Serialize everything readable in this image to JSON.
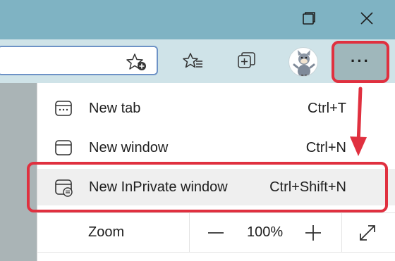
{
  "window": {
    "controls": [
      "restore-icon",
      "close-icon"
    ]
  },
  "toolbar": {
    "address_icon": "add-to-favorites-icon",
    "buttons": [
      "favorites-icon",
      "collections-icon",
      "profile-avatar",
      "more-icon"
    ],
    "more_label": "···"
  },
  "menu": {
    "items": [
      {
        "icon": "new-tab-icon",
        "label": "New tab",
        "shortcut": "Ctrl+T"
      },
      {
        "icon": "new-window-icon",
        "label": "New window",
        "shortcut": "Ctrl+N"
      },
      {
        "icon": "inprivate-icon",
        "label": "New InPrivate window",
        "shortcut": "Ctrl+Shift+N"
      }
    ],
    "zoom": {
      "label": "Zoom",
      "value": "100%",
      "decrease": "—",
      "increase": "+"
    }
  },
  "annotations": {
    "highlight_color": "#e0303f"
  },
  "colors": {
    "titlebar": "#7fb3c3",
    "toolbar": "#cfe3e8",
    "more_button": "#9fb7bb"
  }
}
